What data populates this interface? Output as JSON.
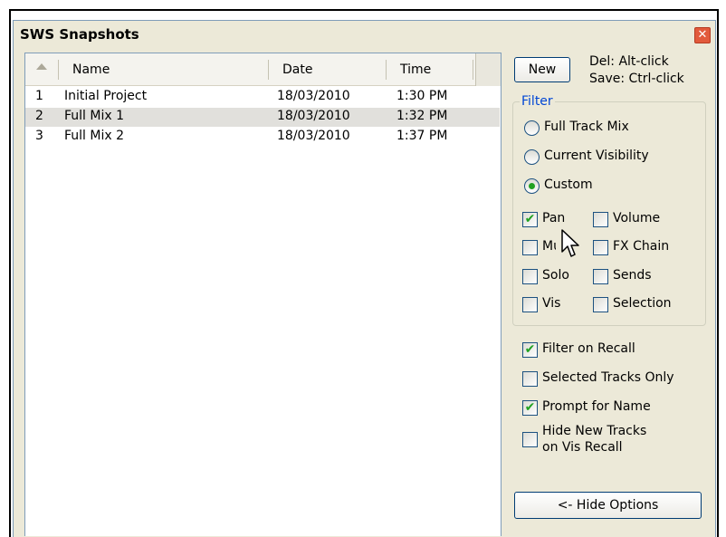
{
  "window": {
    "title": "SWS Snapshots",
    "close_glyph": "✕"
  },
  "list": {
    "columns": [
      "Name",
      "Date",
      "Time"
    ],
    "rows": [
      {
        "num": "1",
        "name": "Initial Project",
        "date": "18/03/2010",
        "time": "1:30 PM"
      },
      {
        "num": "2",
        "name": "Full Mix 1",
        "date": "18/03/2010",
        "time": "1:32 PM"
      },
      {
        "num": "3",
        "name": "Full Mix 2",
        "date": "18/03/2010",
        "time": "1:37 PM"
      }
    ]
  },
  "toolbar": {
    "new_label": "New",
    "hint_del": "Del: Alt-click",
    "hint_save": "Save: Ctrl-click"
  },
  "filter": {
    "label": "Filter",
    "radios": {
      "full_track_mix": "Full Track Mix",
      "current_visibility": "Current Visibility",
      "custom": "Custom"
    },
    "selected_radio": "Custom",
    "checks": {
      "pan": "Pan",
      "volume": "Volume",
      "mute": "Mute",
      "fx_chain": "FX Chain",
      "solo": "Solo",
      "sends": "Sends",
      "vis": "Vis",
      "selection": "Selection"
    },
    "checked": [
      "Pan"
    ]
  },
  "options": {
    "filter_on_recall": "Filter on Recall",
    "selected_tracks_only": "Selected Tracks Only",
    "prompt_for_name": "Prompt for Name",
    "hide_new_tracks_line1": "Hide New Tracks",
    "hide_new_tracks_line2": "on Vis Recall",
    "checked": [
      "Filter on Recall",
      "Prompt for Name"
    ]
  },
  "footer": {
    "hide_options_label": "<- Hide Options"
  },
  "check_glyph": "✔",
  "icons": {
    "cursor": "mouse-pointer-icon",
    "close": "close-icon",
    "sort": "sort-ascending-icon"
  },
  "colors": {
    "accent": "#0046d5",
    "check": "#21a121",
    "selection_row": "#e1e0dc"
  }
}
